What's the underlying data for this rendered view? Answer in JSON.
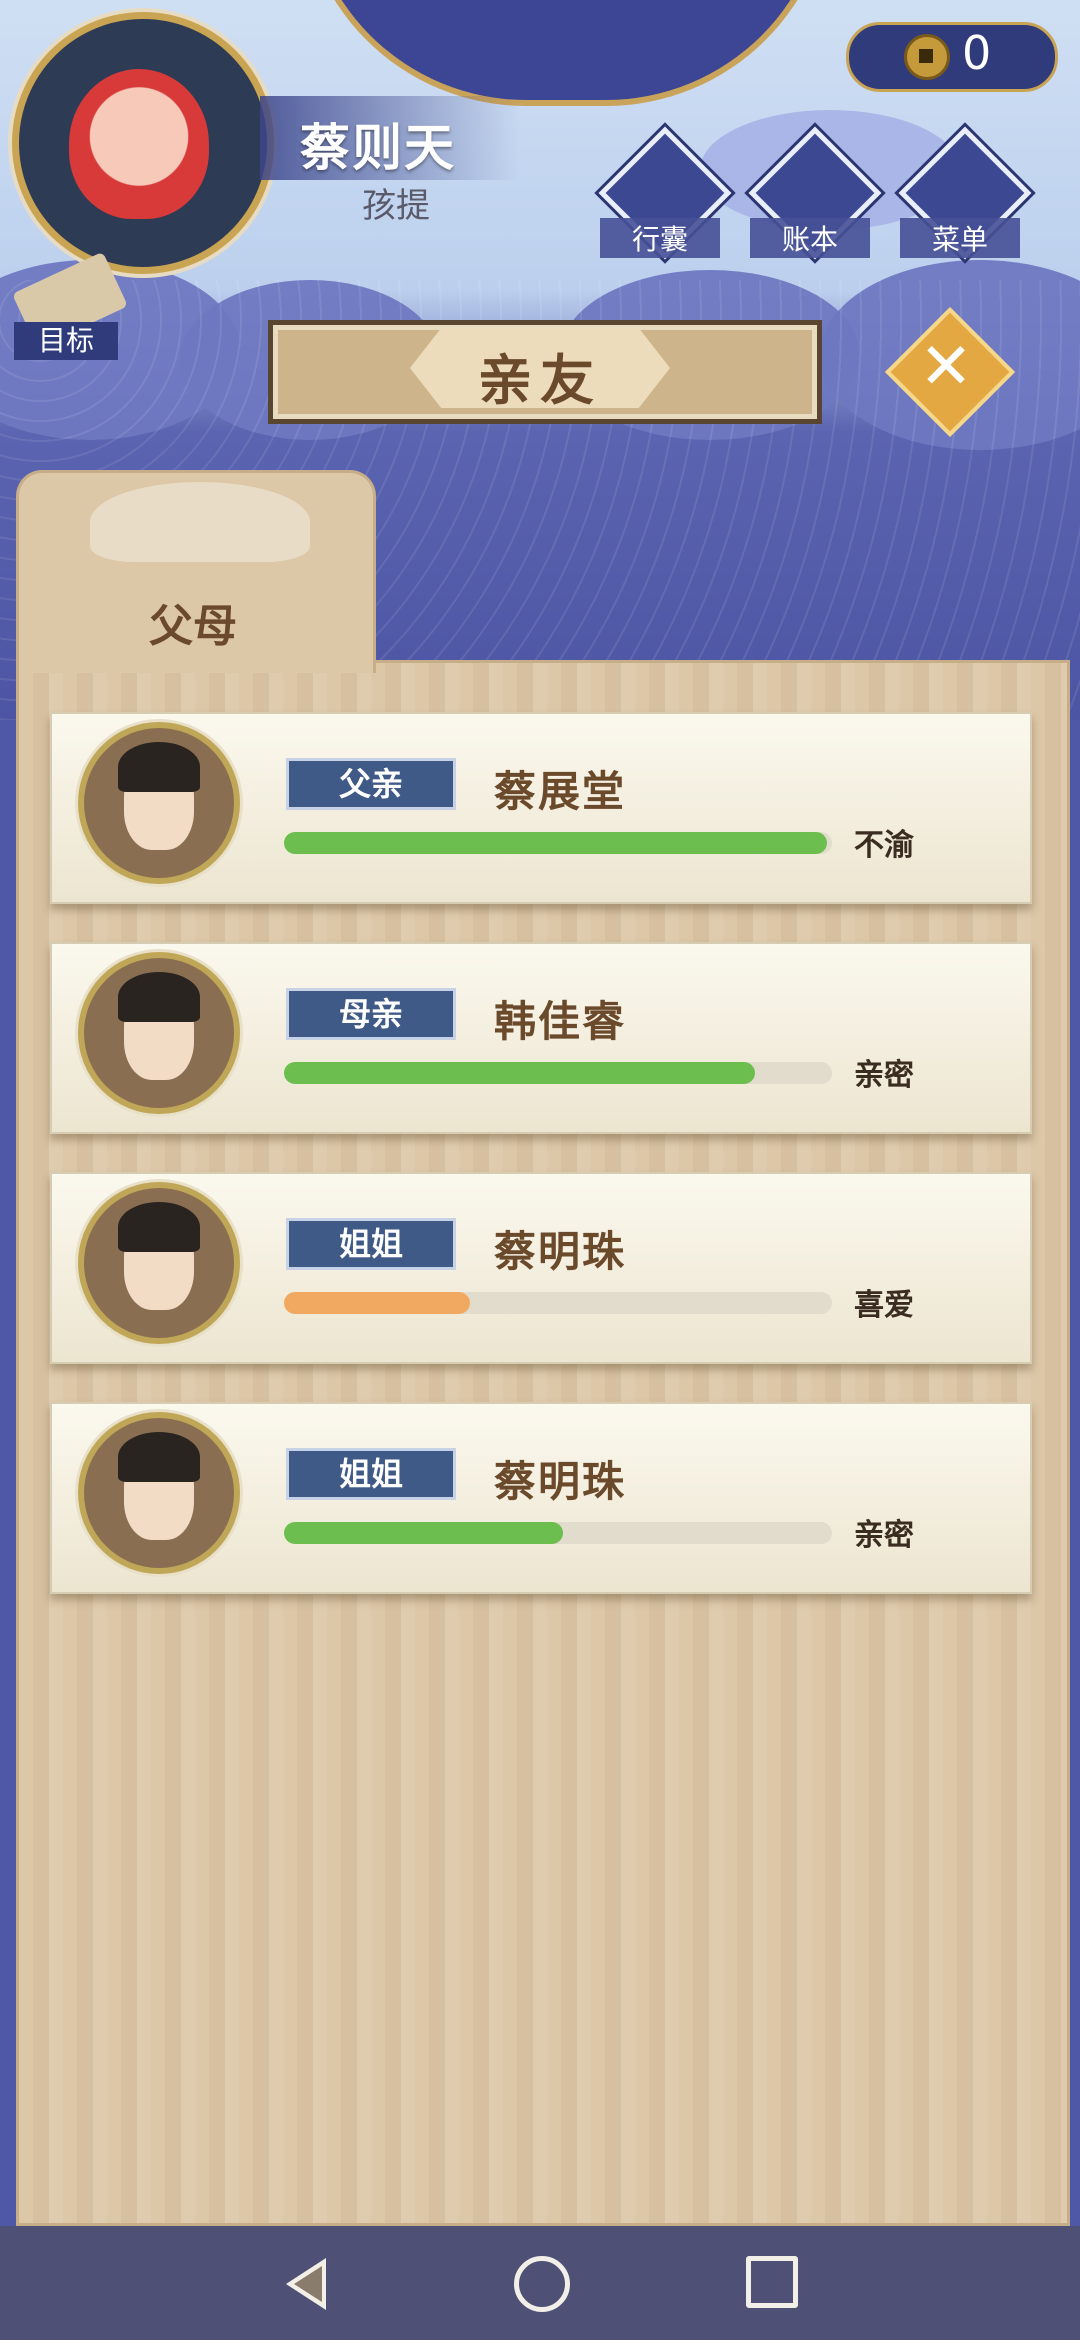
{
  "player": {
    "name": "蔡则天",
    "title": "孩提"
  },
  "currency": {
    "amount": "0",
    "icon": "coin-icon"
  },
  "top_buttons": [
    {
      "label": "行囊",
      "icon": "bag-icon"
    },
    {
      "label": "账本",
      "icon": "ledger-icon"
    },
    {
      "label": "菜单",
      "icon": "menu-dots-icon"
    }
  ],
  "goal": {
    "label": "目标",
    "icon": "scroll-icon"
  },
  "panel": {
    "title": "亲友",
    "close_icon": "close-icon"
  },
  "tabs": [
    {
      "label": "父母"
    }
  ],
  "members": [
    {
      "relation": "父亲",
      "name": "蔡展堂",
      "status": "不渝",
      "affinity": 0.99,
      "bar_color": "#6cbf4e"
    },
    {
      "relation": "母亲",
      "name": "韩佳睿",
      "status": "亲密",
      "affinity": 0.86,
      "bar_color": "#6cbf4e"
    },
    {
      "relation": "姐姐",
      "name": "蔡明珠",
      "status": "喜爱",
      "affinity": 0.34,
      "bar_color": "#f1a962"
    },
    {
      "relation": "姐姐",
      "name": "蔡明珠",
      "status": "亲密",
      "affinity": 0.51,
      "bar_color": "#6cbf4e"
    }
  ],
  "navbar": {
    "back": "back-icon",
    "home": "home-icon",
    "recent": "recent-apps-icon"
  }
}
